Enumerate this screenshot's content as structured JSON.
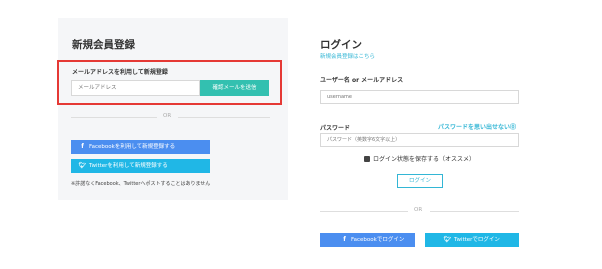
{
  "register": {
    "title": "新規会員登録",
    "email_label": "メールアドレスを利用して新規登録",
    "email_placeholder": "メールアドレス",
    "send_button": "確認メールを送信",
    "or_text": "OR",
    "facebook_button": "Facebookを利用して新規登録する",
    "twitter_button": "Twitterを利用して新規登録する",
    "note": "※許諾なくFacebook、Twitterへポストすることはありません"
  },
  "login": {
    "title": "ログイン",
    "register_link": "新規会員登録はこちら",
    "username_label": "ユーザー名 or メールアドレス",
    "username_placeholder": "username",
    "password_label": "パスワード",
    "forgot_link": "パスワードを思い出せない⓪",
    "password_placeholder": "パスワード（英数字6文字以上）",
    "remember_label": "ログイン状態を保存する（オススメ）",
    "login_button": "ログイン",
    "or_text": "OR",
    "facebook_button": "Facebookでログイン",
    "twitter_button": "Twitterでログイン"
  },
  "icons": {
    "facebook": "facebook-icon",
    "twitter": "twitter-icon"
  },
  "colors": {
    "highlight": "#e53935",
    "accent": "#33c0b0",
    "link": "#33b6d5",
    "facebook": "#4b8ef0",
    "twitter": "#20b7e6"
  }
}
